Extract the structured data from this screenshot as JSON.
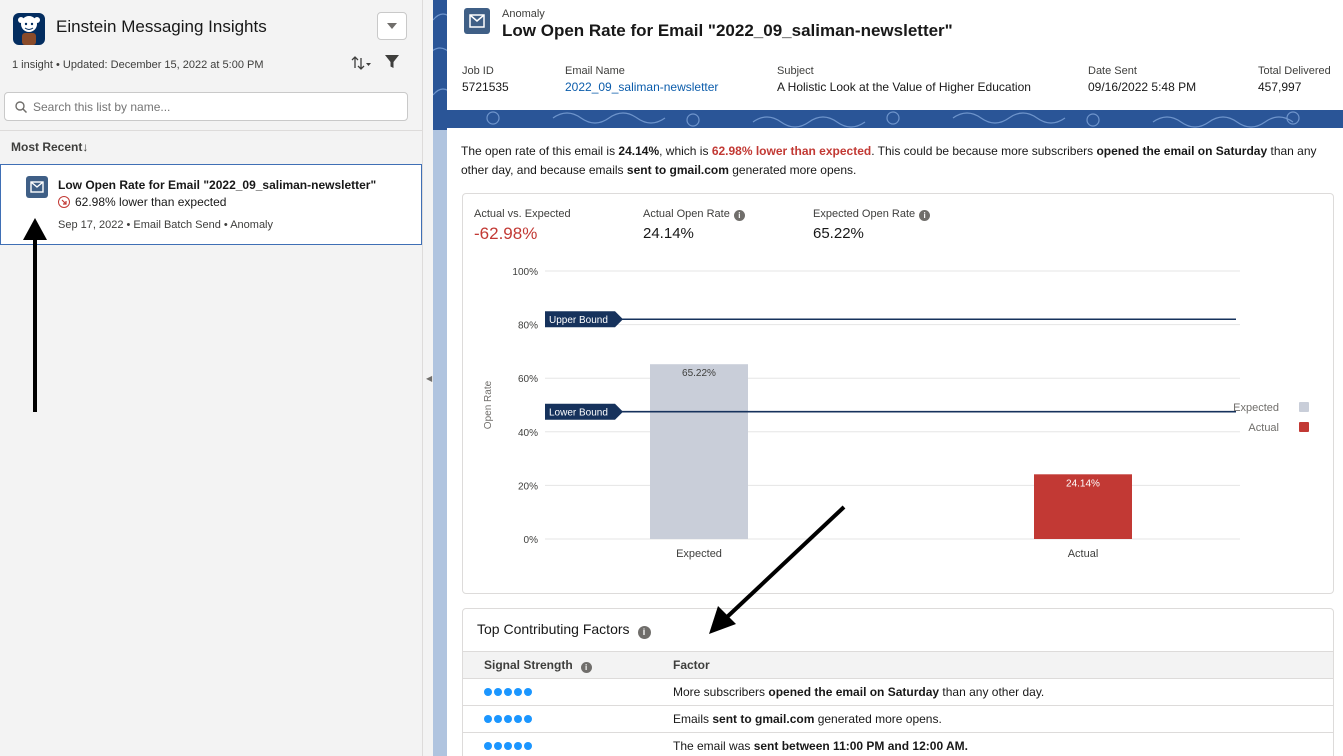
{
  "app": {
    "title": "Einstein Messaging Insights",
    "meta": "1 insight • Updated: December 15, 2022 at 5:00 PM",
    "search_placeholder": "Search this list by name...",
    "sort_label": "Most Recent"
  },
  "list": {
    "items": [
      {
        "title": "Low Open Rate for Email \"2022_09_saliman-newsletter\"",
        "subtitle": "62.98% lower than expected",
        "meta": "Sep 17, 2022 • Email Batch Send • Anomaly",
        "icon": "email-icon"
      }
    ]
  },
  "record": {
    "type": "Anomaly",
    "title": "Low Open Rate for Email \"2022_09_saliman-newsletter\"",
    "fields": [
      {
        "label": "Job ID",
        "value": "5721535"
      },
      {
        "label": "Email Name",
        "value": "2022_09_saliman-newsletter"
      },
      {
        "label": "Subject",
        "value": "A Holistic Look at the Value of Higher Education"
      },
      {
        "label": "Date Sent",
        "value": "09/16/2022 5:48 PM"
      },
      {
        "label": "Total Delivered",
        "value": "457,997"
      }
    ]
  },
  "summary": {
    "p1": "The open rate of this email is ",
    "p2": "24.14%",
    "p3": ", which is ",
    "p4": "62.98% lower than expected",
    "p5": ". This could be because more subscribers ",
    "p6": "opened the email on Saturday",
    "p7": " than any other day, and because emails ",
    "p8": "sent to gmail.com",
    "p9": " generated more opens."
  },
  "kpis": {
    "actual_vs_expected_label": "Actual vs. Expected",
    "actual_vs_expected_value": "-62.98%",
    "actual_label": "Actual Open Rate",
    "actual_value": "24.14%",
    "expected_label": "Expected Open Rate",
    "expected_value": "65.22%"
  },
  "chart_data": {
    "type": "bar",
    "categories": [
      "Expected",
      "Actual"
    ],
    "values": [
      65.22,
      24.14
    ],
    "value_labels": [
      "65.22%",
      "24.14%"
    ],
    "ylabel": "Open Rate",
    "ylim": [
      0,
      100
    ],
    "yticks": [
      "0%",
      "20%",
      "40%",
      "60%",
      "80%",
      "100%"
    ],
    "upper_bound": 82,
    "lower_bound": 47.5,
    "upper_bound_label": "Upper Bound",
    "lower_bound_label": "Lower Bound",
    "legend": [
      "Expected",
      "Actual"
    ],
    "legend_placement": "right",
    "colors": {
      "expected": "#c9ced9",
      "actual": "#c23934",
      "bound": "#16325c"
    },
    "grid": true
  },
  "factors": {
    "title": "Top Contributing Factors",
    "col_strength": "Signal Strength",
    "col_factor": "Factor",
    "rows": [
      {
        "a": "More subscribers ",
        "b": "opened the email on Saturday",
        "c": " than any other day."
      },
      {
        "a": "Emails ",
        "b": "sent to gmail.com",
        "c": " generated more opens."
      },
      {
        "a": "The email was ",
        "b": "sent between 11:00 PM and 12:00 AM.",
        "c": ""
      }
    ]
  }
}
